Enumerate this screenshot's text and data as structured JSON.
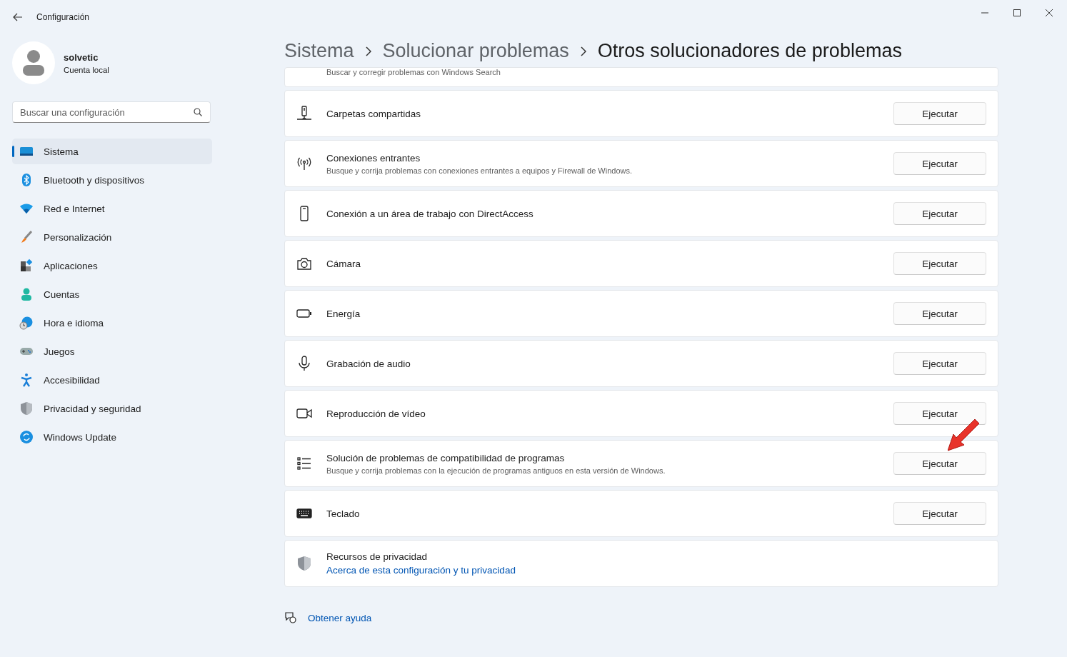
{
  "window": {
    "title": "Configuración"
  },
  "user": {
    "name": "solvetic",
    "account": "Cuenta local"
  },
  "search": {
    "placeholder": "Buscar una configuración"
  },
  "sidebar": {
    "items": [
      {
        "label": "Sistema",
        "selected": true
      },
      {
        "label": "Bluetooth y dispositivos",
        "selected": false
      },
      {
        "label": "Red e Internet",
        "selected": false
      },
      {
        "label": "Personalización",
        "selected": false
      },
      {
        "label": "Aplicaciones",
        "selected": false
      },
      {
        "label": "Cuentas",
        "selected": false
      },
      {
        "label": "Hora e idioma",
        "selected": false
      },
      {
        "label": "Juegos",
        "selected": false
      },
      {
        "label": "Accesibilidad",
        "selected": false
      },
      {
        "label": "Privacidad y seguridad",
        "selected": false
      },
      {
        "label": "Windows Update",
        "selected": false
      }
    ]
  },
  "breadcrumb": [
    "Sistema",
    "Solucionar problemas",
    "Otros solucionadores de problemas"
  ],
  "rows": [
    {
      "kind": "partial",
      "description": "Buscar y corregir problemas con Windows Search"
    },
    {
      "kind": "runner",
      "title": "Carpetas compartidas",
      "button": "Ejecutar"
    },
    {
      "kind": "runner",
      "title": "Conexiones entrantes",
      "description": "Busque y corrija problemas con conexiones entrantes a equipos y Firewall de Windows.",
      "button": "Ejecutar"
    },
    {
      "kind": "runner",
      "title": "Conexión a un área de trabajo con DirectAccess",
      "button": "Ejecutar"
    },
    {
      "kind": "runner",
      "title": "Cámara",
      "button": "Ejecutar"
    },
    {
      "kind": "runner",
      "title": "Energía",
      "button": "Ejecutar"
    },
    {
      "kind": "runner",
      "title": "Grabación de audio",
      "button": "Ejecutar"
    },
    {
      "kind": "runner",
      "title": "Reproducción de vídeo",
      "button": "Ejecutar"
    },
    {
      "kind": "runner",
      "title": "Solución de problemas de compatibilidad de programas",
      "description": "Busque y corrija problemas con la ejecución de programas antiguos en esta versión de Windows.",
      "button": "Ejecutar",
      "pointed": true
    },
    {
      "kind": "runner",
      "title": "Teclado",
      "button": "Ejecutar"
    },
    {
      "kind": "link",
      "title": "Recursos de privacidad",
      "link": "Acerca de esta configuración y tu privacidad"
    }
  ],
  "help": {
    "label": "Obtener ayuda"
  }
}
